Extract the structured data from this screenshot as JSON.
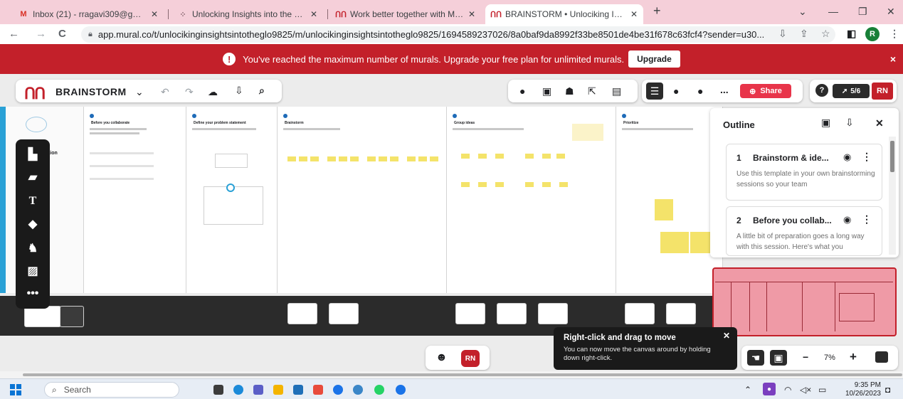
{
  "browser": {
    "tabs": [
      {
        "title": "Inbox (21) - rragavi309@gmail.c",
        "icon": "gmail-icon"
      },
      {
        "title": "Unlocking Insights into the Glob",
        "icon": "loading-icon"
      },
      {
        "title": "Work better together with Mura",
        "icon": "mural-icon"
      },
      {
        "title": "BRAINSTORM • Unlociking Insig",
        "icon": "mural-icon",
        "active": true
      }
    ],
    "url": "app.mural.co/t/unlocikinginsightsintotheglo9825/m/unlocikinginsightsintotheglo9825/1694589237026/8a0baf9da8992f33be8501de4be31f678c63fcf4?sender=u30...",
    "profile_initial": "R"
  },
  "banner": {
    "message": "You've reached the maximum number of murals. Upgrade your free plan for unlimited murals.",
    "button": "Upgrade",
    "close": "×"
  },
  "toolbar": {
    "logo": "ՈՈ",
    "title": "BRAINSTORM",
    "share_label": "Share",
    "timer_label": "5/6",
    "user_initials": "RN",
    "more": "..."
  },
  "canvas": {
    "panels": [
      {
        "heading": "Before you collaborate"
      },
      {
        "heading": "Define your problem statement"
      },
      {
        "heading": "Brainstorm"
      },
      {
        "heading": "Group ideas"
      },
      {
        "heading": "Prioritize"
      }
    ],
    "side_label": "Prioritization"
  },
  "outline": {
    "title": "Outline",
    "items": [
      {
        "num": "1",
        "name": "Brainstorm & ide...",
        "desc": "Use this template in your own brainstorming sessions so your team"
      },
      {
        "num": "2",
        "name": "Before you collab...",
        "desc": "A little bit of preparation goes a long way with this session. Here's what you"
      }
    ]
  },
  "tooltip": {
    "title": "Right-click and drag to move",
    "desc": "You can now move the canvas around by holding down right-click."
  },
  "zoom": {
    "level": "7%",
    "minus": "−",
    "plus": "+"
  },
  "bottom": {
    "user_initials": "RN"
  },
  "taskbar": {
    "search_placeholder": "Search",
    "time": "9:35 PM",
    "date": "10/26/2023"
  },
  "colors": {
    "brand_red": "#c3202a",
    "banner_red": "#c3202a",
    "share_red": "#e8344a",
    "tab_strip": "#f5cfd9",
    "sticky_yellow": "#f4e36a"
  }
}
